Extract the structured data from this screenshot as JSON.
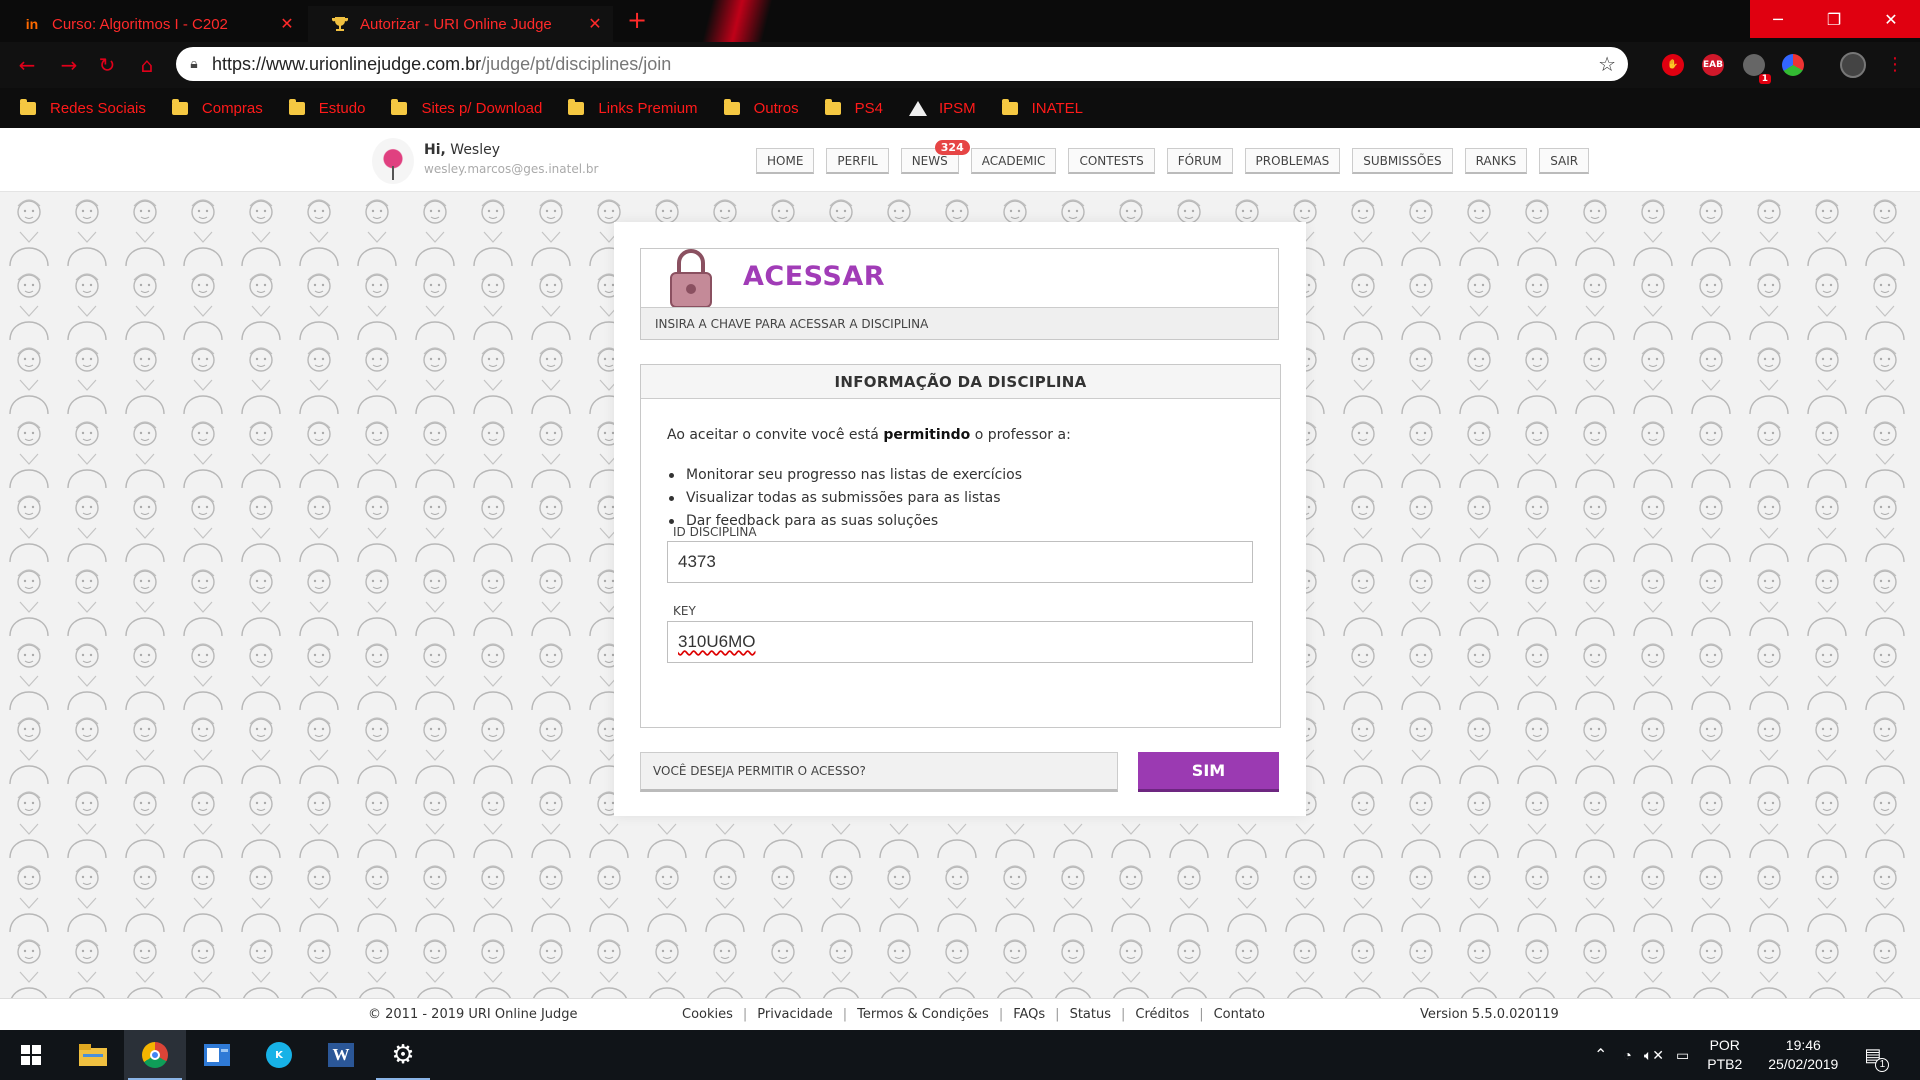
{
  "browser": {
    "tabs": [
      {
        "title": "Curso: Algoritmos I - C202",
        "icon": "in"
      },
      {
        "title": "Autorizar - URI Online Judge",
        "icon": "trophy"
      }
    ],
    "url_main": "https://www.urionlinejudge.com.br",
    "url_path": "/judge/pt/disciplines/join",
    "extension_badge": "1",
    "ext_eab": "EAB",
    "bookmarks": [
      "Redes Sociais",
      "Compras",
      "Estudo",
      "Sites p/ Download",
      "Links Premium",
      "Outros",
      "PS4",
      "IPSM",
      "INATEL"
    ]
  },
  "header": {
    "hi_prefix": "Hi,",
    "user_name": "Wesley",
    "email": "wesley.marcos@ges.inatel.br",
    "nav": [
      "HOME",
      "PERFIL",
      "NEWS",
      "ACADEMIC",
      "CONTESTS",
      "FÓRUM",
      "PROBLEMAS",
      "SUBMISSÕES",
      "RANKS",
      "SAIR"
    ],
    "news_badge": "324"
  },
  "access": {
    "title": "ACESSAR",
    "subtitle": "INSIRA A CHAVE PARA ACESSAR A DISCIPLINA"
  },
  "info": {
    "heading": "INFORMAÇÃO DA DISCIPLINA",
    "intro_pre": "Ao aceitar o convite você está",
    "intro_bold": "permitindo",
    "intro_post": "o professor a:",
    "permissions": [
      "Monitorar seu progresso nas listas de exercícios",
      "Visualizar todas as submissões para as listas",
      "Dar feedback para as suas soluções"
    ],
    "id_label": "ID DISCIPLINA",
    "id_value": "4373",
    "key_label": "KEY",
    "key_value": "310U6MO"
  },
  "confirm": {
    "question": "VOCÊ DESEJA PERMITIR O ACESSO?",
    "button": "SIM"
  },
  "footer": {
    "copyright": "© 2011 - 2019 URI Online Judge",
    "links": [
      "Cookies",
      "Privacidade",
      "Termos & Condições",
      "FAQs",
      "Status",
      "Créditos",
      "Contato"
    ],
    "version": "Version 5.5.0.020119"
  },
  "taskbar": {
    "lang_top": "POR",
    "lang_bottom": "PTB2",
    "time": "19:46",
    "date": "25/02/2019",
    "notif_count": "1"
  },
  "colors": {
    "accent_purple": "#9b3ab2",
    "browser_red": "#ff1a1a",
    "title_purple": "#a13cb7"
  }
}
